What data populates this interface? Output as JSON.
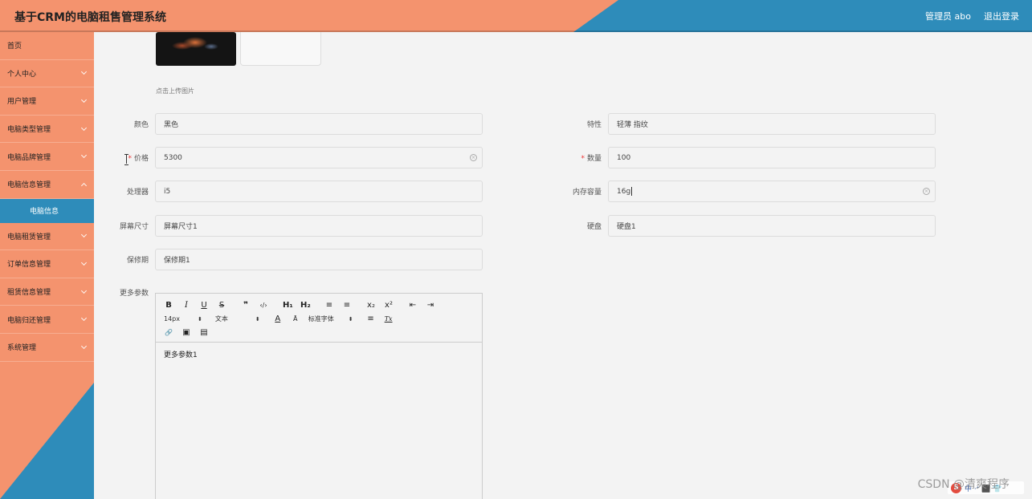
{
  "header": {
    "title": "基于CRM的电脑租售管理系统",
    "user": "管理员 abo",
    "logout": "退出登录"
  },
  "colors": {
    "accent_orange": "#f4936e",
    "accent_blue": "#2e8cba"
  },
  "sidebar": {
    "items": [
      {
        "label": "首页"
      },
      {
        "label": "个人中心"
      },
      {
        "label": "用户管理"
      },
      {
        "label": "电脑类型管理"
      },
      {
        "label": "电脑品牌管理"
      },
      {
        "label": "电脑信息管理"
      },
      {
        "label": "电脑租赁管理"
      },
      {
        "label": "订单信息管理"
      },
      {
        "label": "租赁信息管理"
      },
      {
        "label": "电脑归还管理"
      },
      {
        "label": "系统管理"
      }
    ],
    "active_sub": "电脑信息"
  },
  "upload": {
    "hint": "点击上传图片"
  },
  "form": {
    "color": {
      "label": "颜色",
      "value": "黑色"
    },
    "feature": {
      "label": "特性",
      "value": "轻薄 指纹"
    },
    "price": {
      "label": "价格",
      "value": "5300"
    },
    "quantity": {
      "label": "数量",
      "value": "100"
    },
    "cpu": {
      "label": "处理器",
      "value": "i5"
    },
    "memory": {
      "label": "内存容量",
      "value": "16g"
    },
    "screen": {
      "label": "屏幕尺寸",
      "value": "屏幕尺寸1"
    },
    "disk": {
      "label": "硬盘",
      "value": "硬盘1"
    },
    "warranty": {
      "label": "保修期",
      "value": "保修期1"
    },
    "more": {
      "label": "更多参数"
    },
    "required_mark": "*"
  },
  "editor": {
    "toolbar": {
      "bold": "B",
      "italic": "I",
      "underline": "U",
      "strike": "S",
      "quote": "❞",
      "code": "‹/›",
      "h1": "H₁",
      "h2": "H₂",
      "ol": "≡",
      "ul": "≡",
      "sub": "x₂",
      "sup": "x²",
      "outdent": "⇤",
      "indent": "⇥",
      "size": "14px",
      "type": "文本",
      "font": "标准字体",
      "color": "A",
      "bg": "Ā",
      "align": "≡",
      "clean": "Tx",
      "link": "🔗",
      "image": "▣",
      "video": "▤"
    },
    "content": "更多参数1"
  },
  "watermark": {
    "text": "CSDN @清爽程序",
    "badge_logo": "S",
    "badge_text": "中 ·ᐩ ⬛ 👕"
  }
}
